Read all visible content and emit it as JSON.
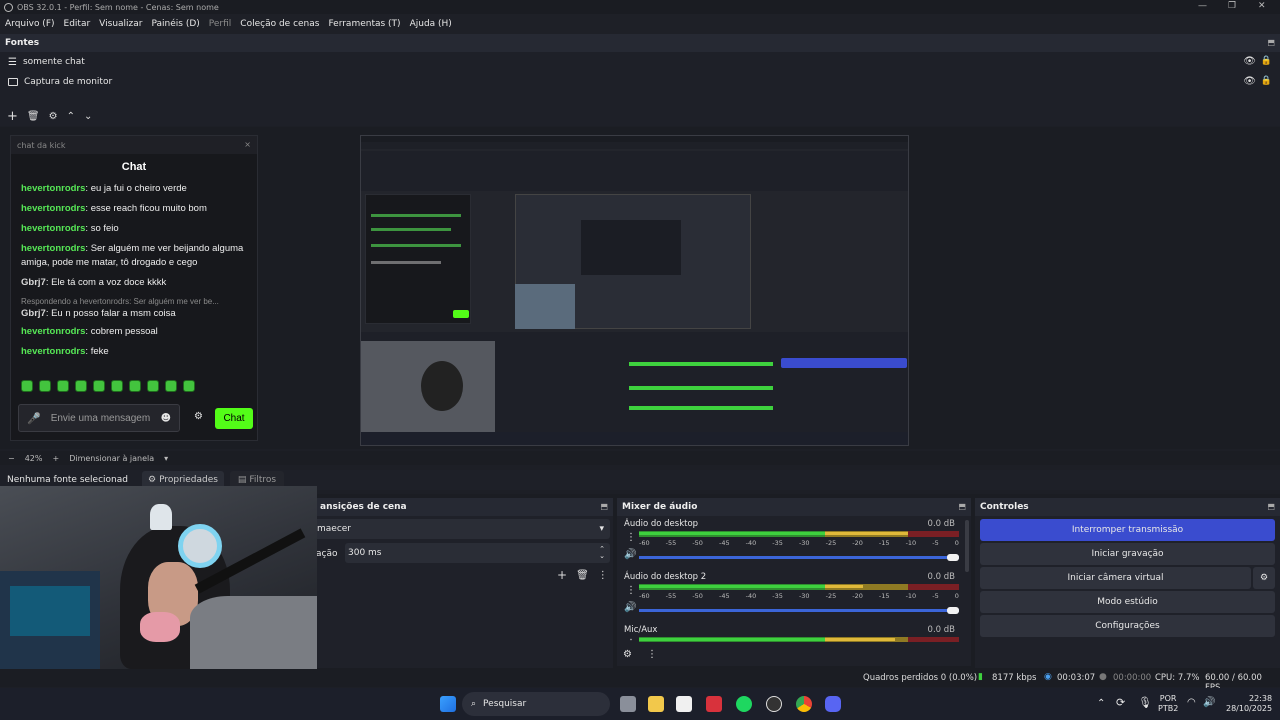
{
  "window": {
    "title": "OBS 32.0.1 - Perfil: Sem nome - Cenas: Sem nome"
  },
  "menu": [
    "Arquivo (F)",
    "Editar",
    "Visualizar",
    "Painéis (D)",
    "Perfil",
    "Coleção de cenas",
    "Ferramentas (T)",
    "Ajuda (H)"
  ],
  "sources": {
    "title": "Fontes",
    "items": [
      {
        "label": "somente chat",
        "icon": "list-icon"
      },
      {
        "label": "Captura de monitor",
        "icon": "monitor-icon"
      }
    ]
  },
  "chat_dock": {
    "tab_label": "chat da kick",
    "title": "Chat",
    "messages": [
      {
        "user": "hevertonrodrs",
        "text": "eu ja fui o cheiro verde",
        "color": "#56e756"
      },
      {
        "user": "hevertonrodrs",
        "text": "esse reach ficou muito bom",
        "color": "#56e756"
      },
      {
        "user": "hevertonrodrs",
        "text": "so feio",
        "color": "#56e756"
      },
      {
        "user": "hevertonrodrs",
        "text": "Ser alguém me ver beijando alguma amiga, pode me matar, tô drogado e cego",
        "color": "#56e756"
      },
      {
        "user": "Gbrj7",
        "text": "Ele tá com a voz doce kkkk",
        "color": "#d9d9d9"
      },
      {
        "user": "Gbrj7",
        "text": "Eu n posso falar a msm coisa",
        "color": "#d9d9d9",
        "reply": "Respondendo a hevertonrodrs: Ser alguém me ver be..."
      },
      {
        "user": "hevertonrodrs",
        "text": "cobrem pessoal",
        "color": "#56e756"
      },
      {
        "user": "hevertonrodrs",
        "text": "feke",
        "color": "#56e756"
      }
    ],
    "input_placeholder": "Envie uma mensagem",
    "send_label": "Chat"
  },
  "preview_zoom": {
    "zoom": "42%",
    "mode": "Dimensionar à janela"
  },
  "context_bar": {
    "no_source": "Nenhuma fonte selecionad",
    "properties": "Propriedades",
    "filters": "Filtros"
  },
  "transitions": {
    "title": "ansições de cena",
    "type": "maecer",
    "duration_label": "ação",
    "duration": "300 ms"
  },
  "mixer": {
    "title": "Mixer de áudio",
    "ticks": [
      "-60",
      "-55",
      "-50",
      "-45",
      "-40",
      "-35",
      "-30",
      "-25",
      "-20",
      "-15",
      "-10",
      "-5",
      "0"
    ],
    "channels": [
      {
        "name": "Áudio do desktop",
        "db": "0.0 dB",
        "level": 0.85
      },
      {
        "name": "Áudio do desktop 2",
        "db": "0.0 dB",
        "level": 0.7
      },
      {
        "name": "Mic/Aux",
        "db": "0.0 dB",
        "level": 0.8
      }
    ]
  },
  "controls": {
    "title": "Controles",
    "stop_stream": "Interromper transmissão",
    "start_rec": "Iniciar gravação",
    "virtual_cam": "Iniciar câmera virtual",
    "studio_mode": "Modo estúdio",
    "settings": "Configurações",
    "accent": "#3a4ccf"
  },
  "status": {
    "dropped": "Quadros perdidos 0 (0.0%)",
    "bitrate": "8177 kbps",
    "stream_time": "00:03:07",
    "rec_time": "00:00:00",
    "cpu": "CPU: 7.7%",
    "fps": "60.00 / 60.00 FPS"
  },
  "taskbar": {
    "search": "Pesquisar",
    "lang": "POR",
    "layout": "PTB2",
    "time": "22:38",
    "date": "28/10/2025"
  }
}
